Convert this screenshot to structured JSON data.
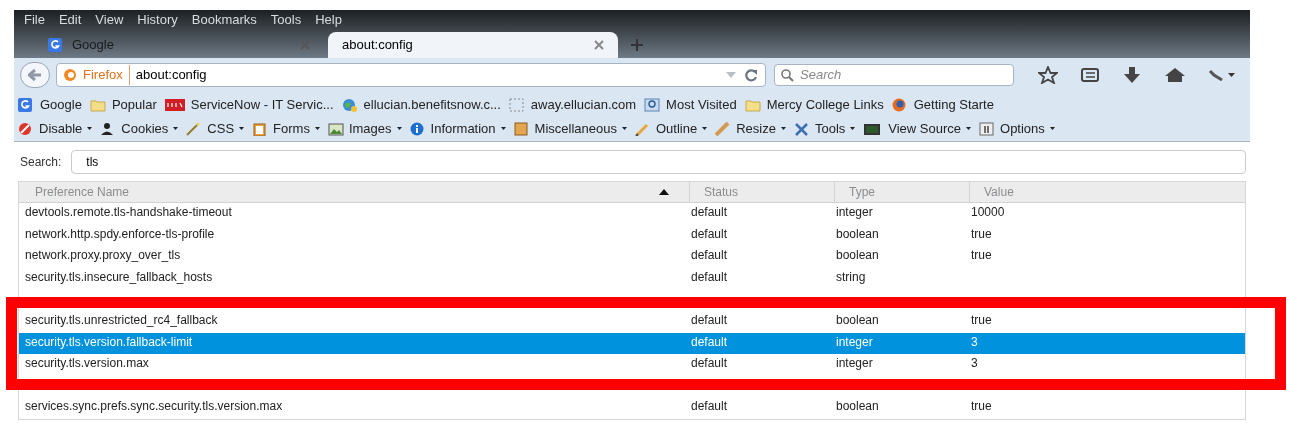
{
  "menu": [
    "File",
    "Edit",
    "View",
    "History",
    "Bookmarks",
    "Tools",
    "Help"
  ],
  "tabs": [
    {
      "label": "Google",
      "selected": false,
      "kind": "google"
    },
    {
      "label": "about:config",
      "selected": true,
      "kind": "plain"
    }
  ],
  "navbar": {
    "identity": "Firefox",
    "url": "about:config",
    "search_placeholder": "Search"
  },
  "bookmarks": [
    {
      "label": "Google",
      "kind": "google"
    },
    {
      "label": "Popular",
      "kind": "folder"
    },
    {
      "label": "ServiceNow - IT Servic...",
      "kind": "now"
    },
    {
      "label": "ellucian.benefitsnow.c...",
      "kind": "globe"
    },
    {
      "label": "away.ellucian.com",
      "kind": "dashed"
    },
    {
      "label": "Most Visited",
      "kind": "search"
    },
    {
      "label": "Mercy College Links",
      "kind": "folder"
    },
    {
      "label": "Getting Starte",
      "kind": "firefox"
    }
  ],
  "devtools": [
    {
      "label": "Disable",
      "kind": "disable"
    },
    {
      "label": "Cookies",
      "kind": "person"
    },
    {
      "label": "CSS",
      "kind": "wand"
    },
    {
      "label": "Forms",
      "kind": "clipboard"
    },
    {
      "label": "Images",
      "kind": "image"
    },
    {
      "label": "Information",
      "kind": "info"
    },
    {
      "label": "Miscellaneous",
      "kind": "box"
    },
    {
      "label": "Outline",
      "kind": "pencil"
    },
    {
      "label": "Resize",
      "kind": "ruler"
    },
    {
      "label": "Tools",
      "kind": "tools"
    },
    {
      "label": "View Source",
      "kind": "terminal"
    },
    {
      "label": "Options",
      "kind": "options"
    }
  ],
  "search": {
    "label": "Search:",
    "value": "tls"
  },
  "columns": [
    "Preference Name",
    "Status",
    "Type",
    "Value"
  ],
  "rows": [
    {
      "name": "devtools.remote.tls-handshake-timeout",
      "status": "default",
      "type": "integer",
      "value": "10000",
      "selected": false,
      "gap_before": false
    },
    {
      "name": "network.http.spdy.enforce-tls-profile",
      "status": "default",
      "type": "boolean",
      "value": "true",
      "selected": false,
      "gap_before": false
    },
    {
      "name": "network.proxy.proxy_over_tls",
      "status": "default",
      "type": "boolean",
      "value": "true",
      "selected": false,
      "gap_before": false
    },
    {
      "name": "security.tls.insecure_fallback_hosts",
      "status": "default",
      "type": "string",
      "value": "",
      "selected": false,
      "gap_before": false
    },
    {
      "name": "security.tls.unrestricted_rc4_fallback",
      "status": "default",
      "type": "boolean",
      "value": "true",
      "selected": false,
      "gap_before": true
    },
    {
      "name": "security.tls.version.fallback-limit",
      "status": "default",
      "type": "integer",
      "value": "3",
      "selected": true,
      "gap_before": false
    },
    {
      "name": "security.tls.version.max",
      "status": "default",
      "type": "integer",
      "value": "3",
      "selected": false,
      "gap_before": false
    },
    {
      "name": "services.sync.prefs.sync.security.tls.version.max",
      "status": "default",
      "type": "boolean",
      "value": "true",
      "selected": false,
      "gap_before": true
    }
  ]
}
